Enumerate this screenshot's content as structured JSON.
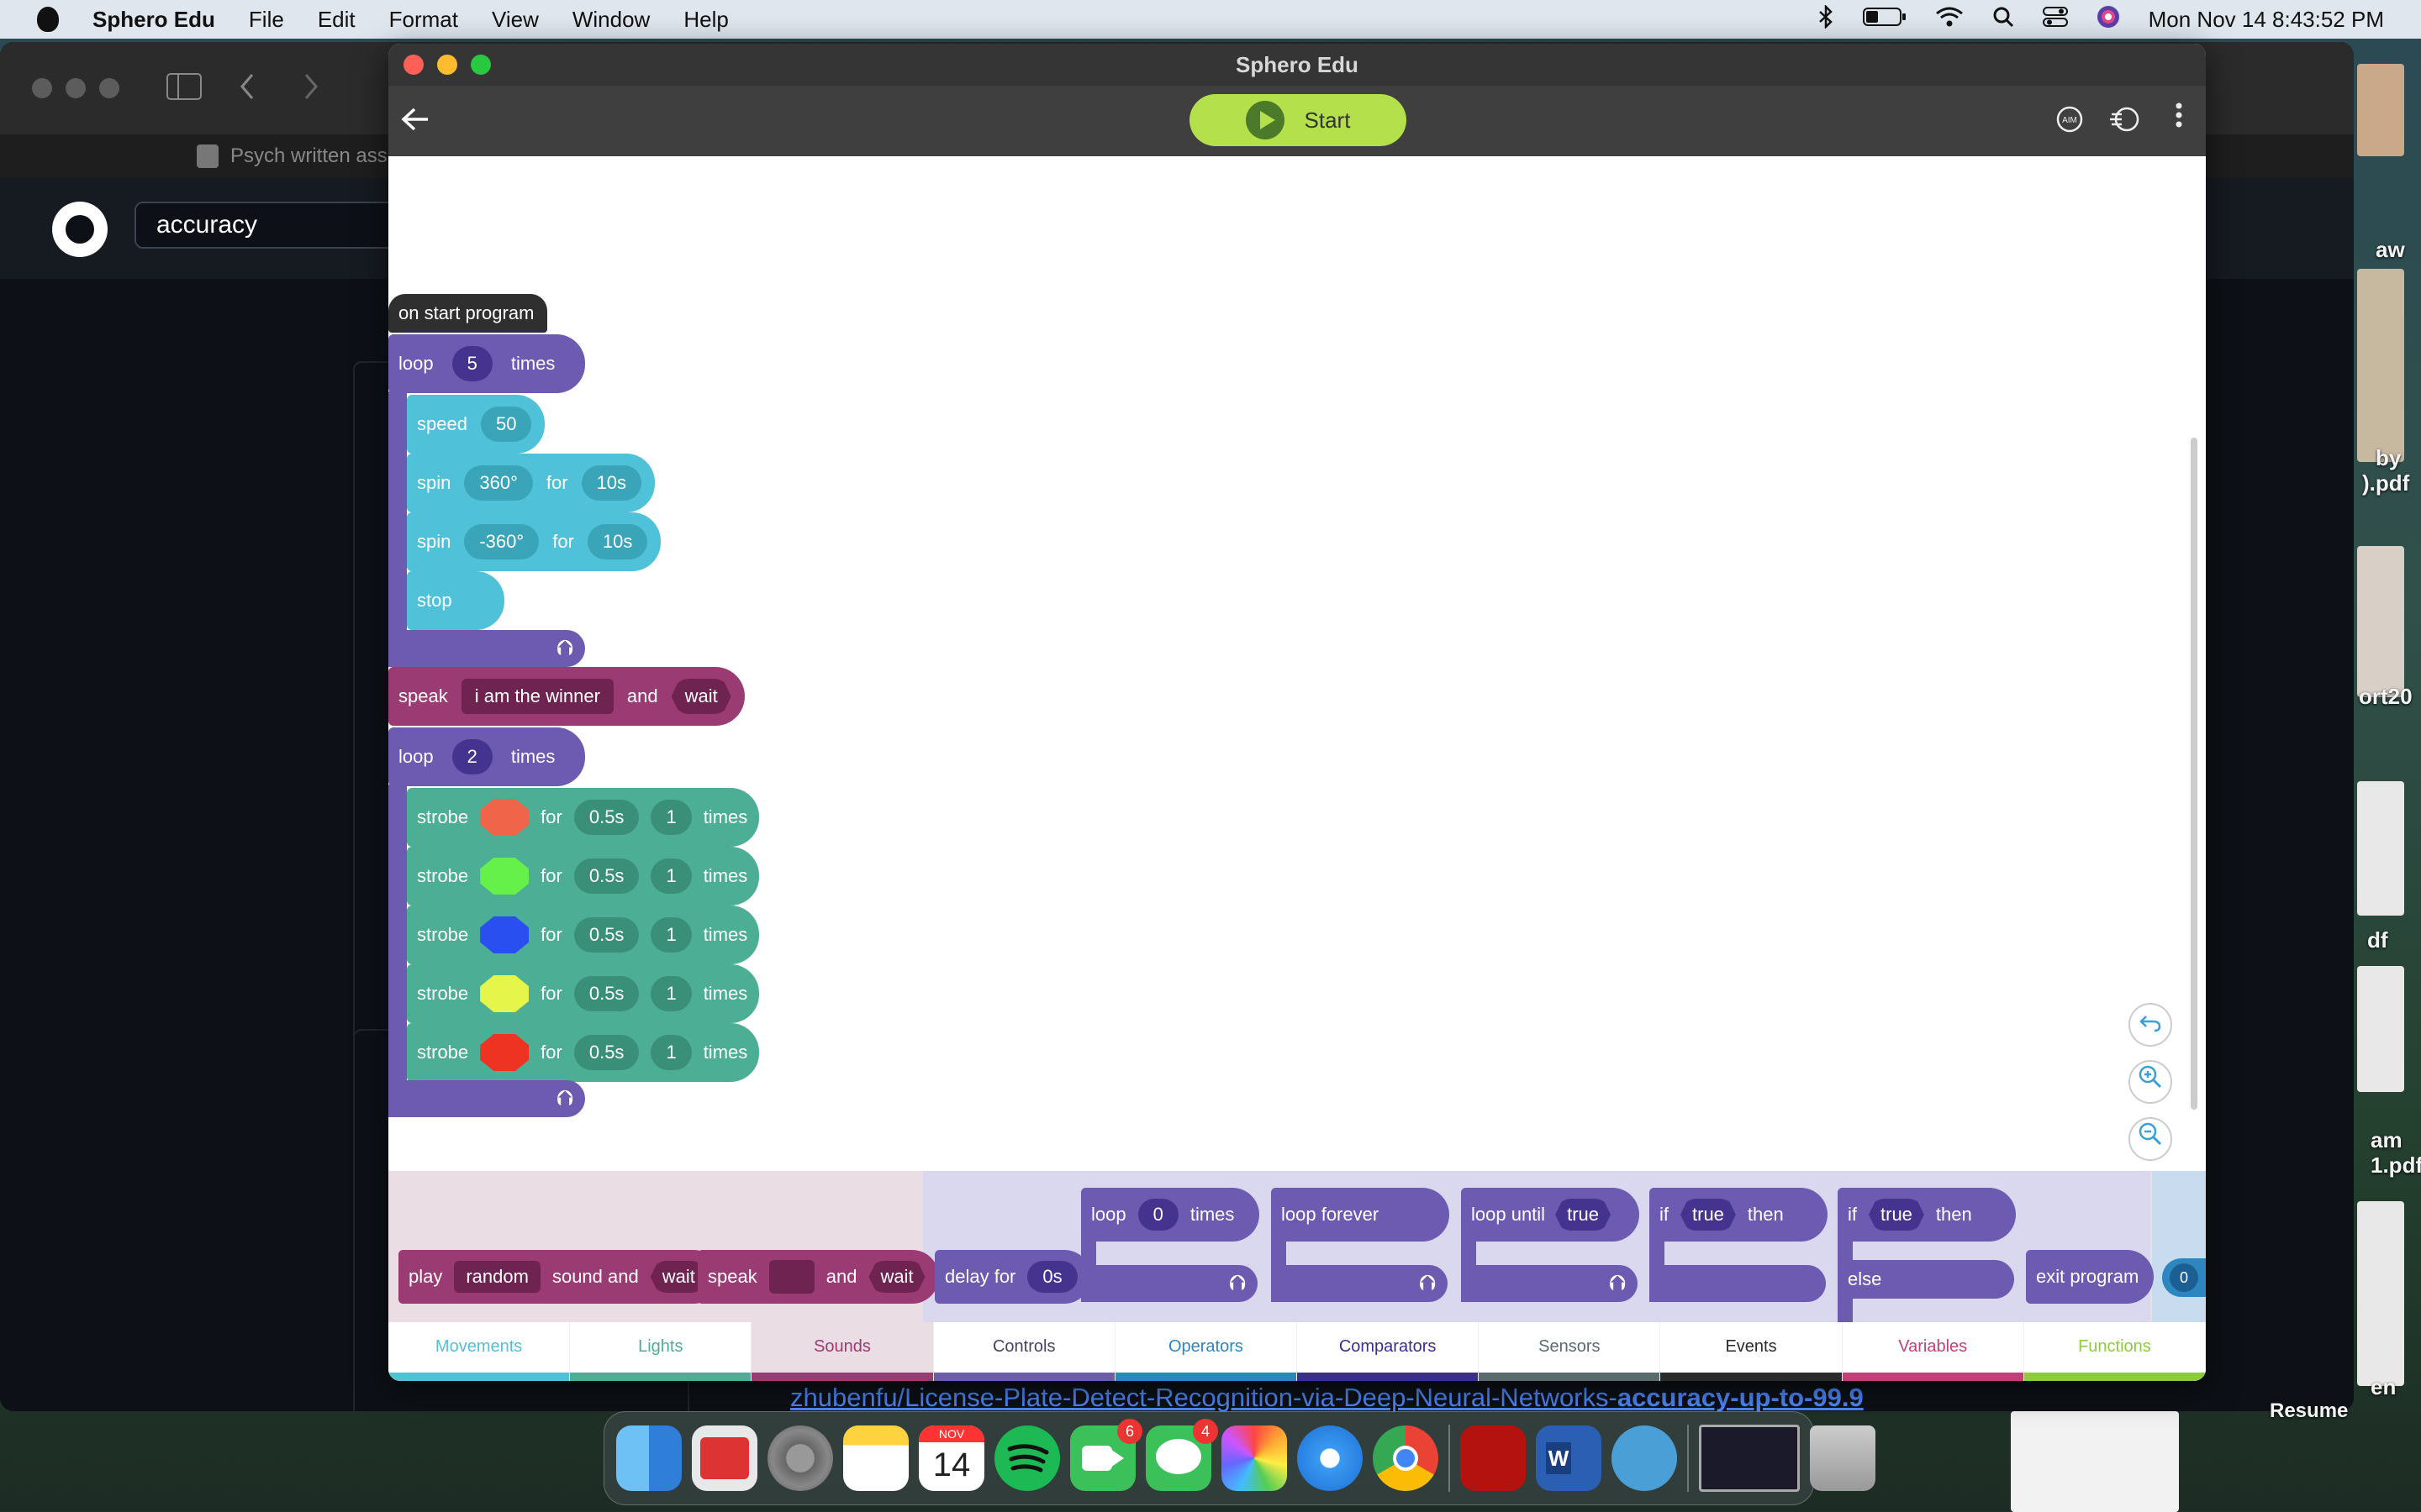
{
  "menubar": {
    "app_name": "Sphero Edu",
    "items": [
      "File",
      "Edit",
      "Format",
      "View",
      "Window",
      "Help"
    ],
    "clock": "Mon Nov 14  8:43:52 PM"
  },
  "browser": {
    "tab_title": "Psych written ass",
    "search_value": "accuracy",
    "footer_link_pre": "zhubenfu/License-Plate-Detect-Recognition-via-Deep-Neural-Networks-",
    "footer_link_bold": "accuracy-up-to-99.9"
  },
  "desktop": {
    "labels": [
      "aw",
      "by",
      ").pdf",
      "ort20",
      "df",
      "am",
      "1.pdf",
      "en",
      "Resume"
    ]
  },
  "app": {
    "window_title": "Sphero Edu",
    "start_label": "Start",
    "aim_label": "AIM"
  },
  "program": {
    "hat": "on start program",
    "loop1": {
      "label": "loop",
      "count": "5",
      "suffix": "times"
    },
    "speed": {
      "label": "speed",
      "value": "50"
    },
    "spin1": {
      "label": "spin",
      "angle": "360°",
      "for": "for",
      "dur": "10s"
    },
    "spin2": {
      "label": "spin",
      "angle": "-360°",
      "for": "for",
      "dur": "10s"
    },
    "stop": "stop",
    "speak": {
      "label": "speak",
      "text": "i am the winner",
      "and": "and",
      "wait": "wait"
    },
    "loop2": {
      "label": "loop",
      "count": "2",
      "suffix": "times"
    },
    "strobes": [
      {
        "label": "strobe",
        "color": "#f0644a",
        "for": "for",
        "dur": "0.5s",
        "count": "1",
        "times": "times"
      },
      {
        "label": "strobe",
        "color": "#66f04a",
        "for": "for",
        "dur": "0.5s",
        "count": "1",
        "times": "times"
      },
      {
        "label": "strobe",
        "color": "#2a4ff0",
        "for": "for",
        "dur": "0.5s",
        "count": "1",
        "times": "times"
      },
      {
        "label": "strobe",
        "color": "#e6f54a",
        "for": "for",
        "dur": "0.5s",
        "count": "1",
        "times": "times"
      },
      {
        "label": "strobe",
        "color": "#ee3322",
        "for": "for",
        "dur": "0.5s",
        "count": "1",
        "times": "times"
      }
    ]
  },
  "palette": {
    "play": {
      "label": "play",
      "value": "random",
      "mid": "sound and",
      "wait": "wait"
    },
    "speak": {
      "label": "speak",
      "and": "and",
      "wait": "wait"
    },
    "delay": {
      "label": "delay for",
      "value": "0s"
    },
    "loop": {
      "label": "loop",
      "value": "0",
      "suffix": "times"
    },
    "loop_forever": "loop forever",
    "loop_until": {
      "label": "loop until",
      "value": "true"
    },
    "if_then": {
      "if": "if",
      "value": "true",
      "then": "then"
    },
    "if_else": {
      "if": "if",
      "value": "true",
      "then": "then",
      "else": "else"
    },
    "exit": "exit program",
    "operator_value": "0"
  },
  "tabs": [
    {
      "label": "Movements",
      "color": "#4fc1d8",
      "text": "#4fc1d8"
    },
    {
      "label": "Lights",
      "color": "#4cae94",
      "text": "#4cae94"
    },
    {
      "label": "Sounds",
      "color": "#9b3b73",
      "text": "#9b3b73"
    },
    {
      "label": "Controls",
      "color": "#6c5bb0",
      "text": "#444466"
    },
    {
      "label": "Operators",
      "color": "#2e86c1",
      "text": "#2e86c1"
    },
    {
      "label": "Comparators",
      "color": "#3a2f8f",
      "text": "#3a2f8f"
    },
    {
      "label": "Sensors",
      "color": "#5a6b70",
      "text": "#5a6b70"
    },
    {
      "label": "Events",
      "color": "#2b2b2b",
      "text": "#2b2b2b"
    },
    {
      "label": "Variables",
      "color": "#c2407a",
      "text": "#c2407a"
    },
    {
      "label": "Functions",
      "color": "#8ccc3c",
      "text": "#8ccc3c"
    }
  ],
  "dock": {
    "calendar_month": "NOV",
    "calendar_day": "14",
    "facetime_badge": "6",
    "messages_badge": "4"
  }
}
